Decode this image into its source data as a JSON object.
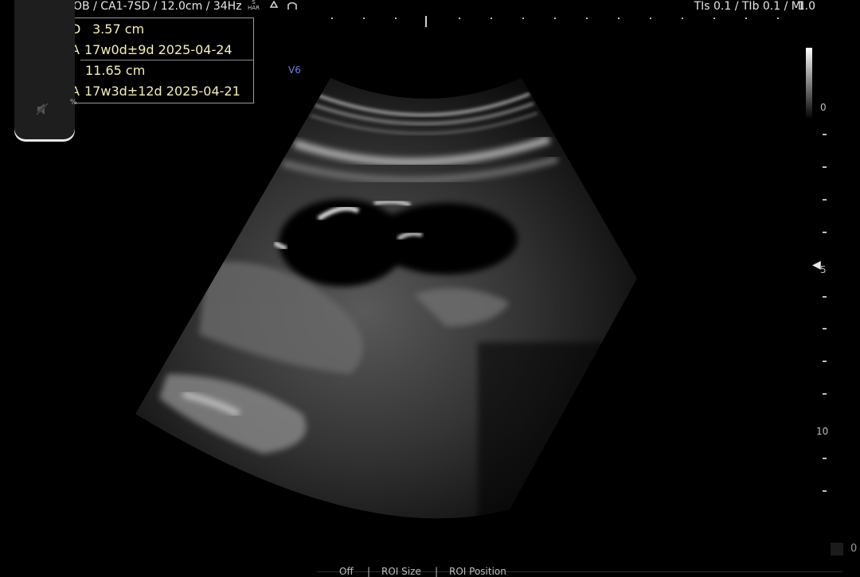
{
  "header": {
    "left_text": "OB / CA1-7SD / 12.0cm / 34Hz",
    "har_label": [
      "S",
      "HAR"
    ],
    "right_text": "TIs  0.1 / TIb  0.1 / MI",
    "mi_value": "1.0"
  },
  "measurements": [
    {
      "label": "D",
      "value": "3.57 cm"
    },
    {
      "label": "A",
      "value": "17w0d±9d  2025-04-24"
    },
    {
      "label": "",
      "value": "11.65 cm"
    },
    {
      "label": "A",
      "value": "17w3d±12d  2025-04-21"
    }
  ],
  "side_panel": {
    "fragment": "%"
  },
  "probe_label": "V6",
  "depth_scale": {
    "labels": [
      "0",
      "5",
      "10"
    ],
    "focus_marker": "◀"
  },
  "bottom_menu": {
    "items": [
      "Off",
      "ROI Size",
      "ROI Position"
    ],
    "separator": "|"
  },
  "corner_value": "0",
  "icons": [
    "speaker-muted-icon",
    "har-icon",
    "recycle-icon",
    "vessel-icon",
    "focus-arrow-icon"
  ],
  "colors": {
    "measurement_text": "#f4f0b6",
    "probe_label": "#6b7fd6",
    "background": "#000000"
  }
}
